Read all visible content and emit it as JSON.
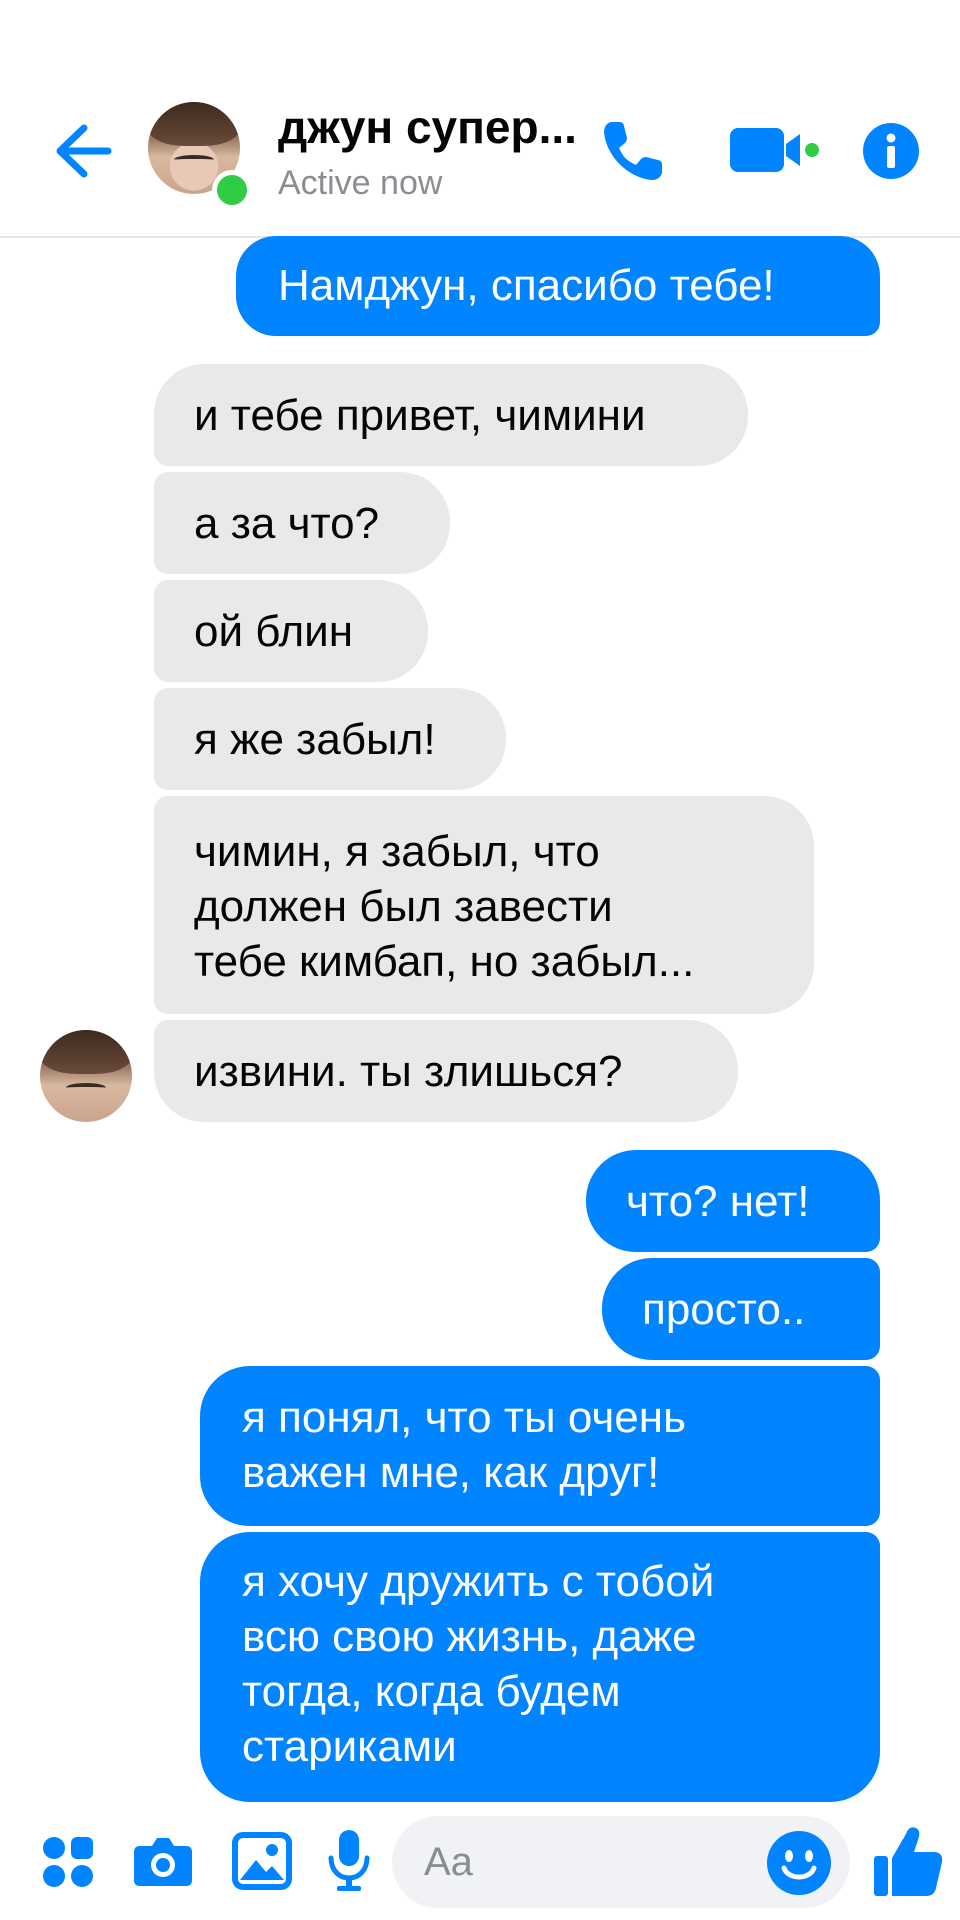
{
  "header": {
    "contact_name": "джун супер...",
    "status": "Active now"
  },
  "messages": [
    {
      "sender": "me",
      "text": "Намджун, спасибо тебе!"
    },
    {
      "sender": "contact",
      "text": "и тебе привет, чимини"
    },
    {
      "sender": "contact",
      "text": "а за что?"
    },
    {
      "sender": "contact",
      "text": "ой блин"
    },
    {
      "sender": "contact",
      "text": "я же забыл!"
    },
    {
      "sender": "contact",
      "text": "чимин, я забыл, что\nдолжен был завести\nтебе кимбап, но забыл..."
    },
    {
      "sender": "contact",
      "text": "извини. ты злишься?"
    },
    {
      "sender": "me",
      "text": "что? нет!"
    },
    {
      "sender": "me",
      "text": "просто.."
    },
    {
      "sender": "me",
      "text": "я понял, что ты очень\nважен мне, как друг!"
    },
    {
      "sender": "me",
      "text": "я хочу дружить с тобой\nвсю свою жизнь, даже\nтогда, когда будем\nстариками"
    }
  ],
  "composer": {
    "placeholder": "Aa"
  },
  "icons": {
    "back": "back-arrow-icon",
    "call": "phone-icon",
    "video": "video-camera-icon",
    "info": "info-icon",
    "apps": "apps-icon",
    "camera": "camera-icon",
    "gallery": "image-icon",
    "mic": "microphone-icon",
    "emoji": "emoji-icon",
    "like": "thumbs-up-icon"
  },
  "colors": {
    "accent": "#0084ff",
    "incoming_bubble": "#e9e9eb",
    "online": "#31cc46"
  }
}
